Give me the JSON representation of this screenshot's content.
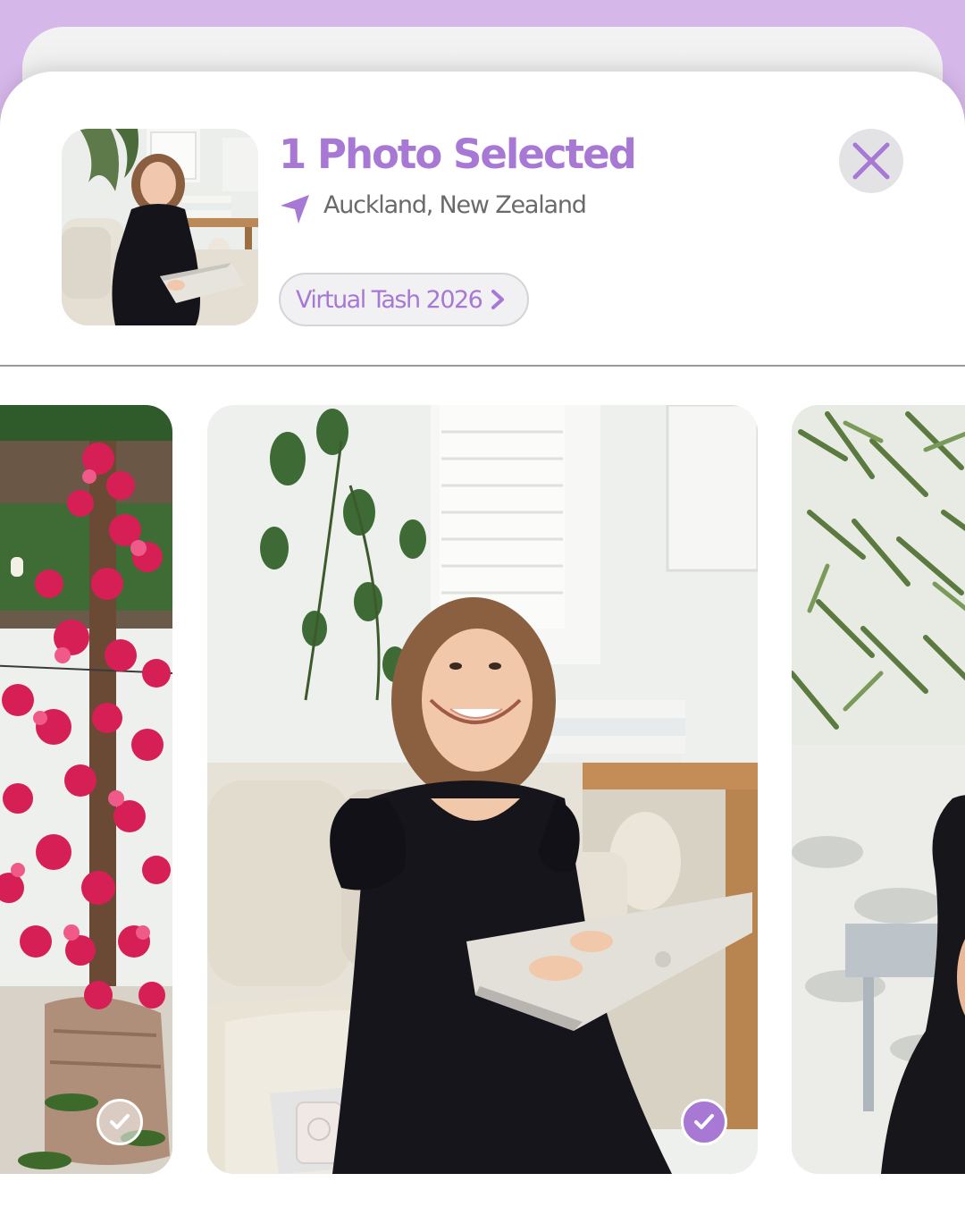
{
  "header": {
    "title": "1 Photo Selected",
    "location": "Auckland, New Zealand",
    "album_label": "Virtual Tash 2026"
  },
  "icons": {
    "location": "location-arrow-icon",
    "album_chevron": "chevron-right-icon",
    "close": "close-icon",
    "check": "checkmark-icon"
  },
  "photos": [
    {
      "subject": "pink bougainvillea on wooden pergola",
      "selected": false
    },
    {
      "subject": "woman in black dress on sofa with laptop",
      "selected": true
    },
    {
      "subject": "olive tree leaves and woman in black dress",
      "selected": false
    }
  ],
  "colors": {
    "accent": "#a778d4",
    "backdrop": "#d6b7ea",
    "sheet": "#ffffff",
    "close_bg": "#e3e3e6",
    "pill_bg": "#f1f1f3"
  }
}
